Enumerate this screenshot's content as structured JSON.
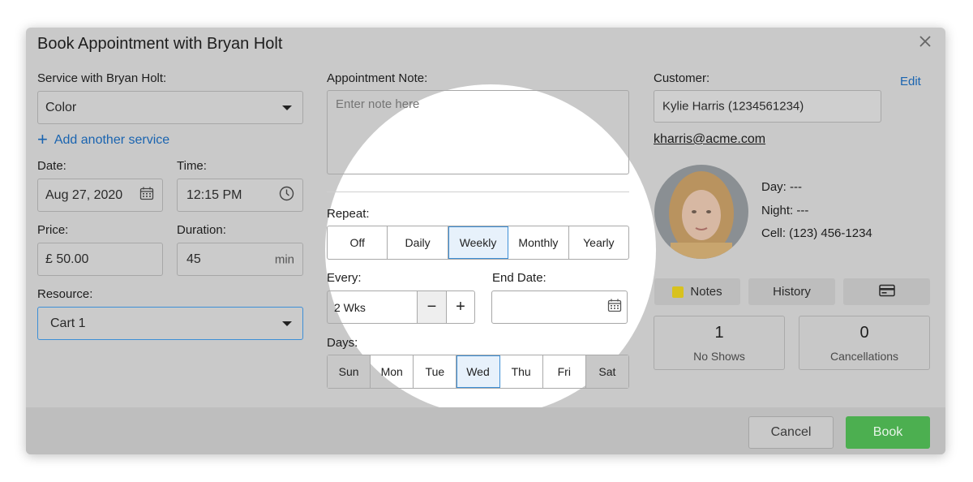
{
  "dialog": {
    "title": "Book Appointment with Bryan Holt"
  },
  "service": {
    "label": "Service with Bryan Holt:",
    "value": "Color",
    "add_link": "Add another service"
  },
  "date": {
    "label": "Date:",
    "value": "Aug 27, 2020"
  },
  "time": {
    "label": "Time:",
    "value": "12:15 PM"
  },
  "price": {
    "label": "Price:",
    "value": "£ 50.00"
  },
  "duration": {
    "label": "Duration:",
    "value": "45",
    "unit": "min"
  },
  "resource": {
    "label": "Resource:",
    "value": "Cart 1"
  },
  "note": {
    "label": "Appointment Note:",
    "placeholder": "Enter note here"
  },
  "repeat": {
    "label": "Repeat:",
    "options": [
      "Off",
      "Daily",
      "Weekly",
      "Monthly",
      "Yearly"
    ],
    "selected": "Weekly"
  },
  "every": {
    "label": "Every:",
    "value": "2  Wks",
    "minus": "−",
    "plus": "+"
  },
  "end_date": {
    "label": "End Date:",
    "value": ""
  },
  "days": {
    "label": "Days:",
    "options": [
      "Sun",
      "Mon",
      "Tue",
      "Wed",
      "Thu",
      "Fri",
      "Sat"
    ],
    "selected": "Wed"
  },
  "customer": {
    "label": "Customer:",
    "edit": "Edit",
    "name": "Kylie Harris (1234561234)",
    "email": "kharris@acme.com",
    "day": "Day: ---",
    "night": "Night: ---",
    "cell": "Cell: (123) 456-1234"
  },
  "tabs": {
    "notes": "Notes",
    "history": "History"
  },
  "stats": {
    "no_shows": {
      "value": "1",
      "label": "No Shows"
    },
    "cancellations": {
      "value": "0",
      "label": "Cancellations"
    }
  },
  "footer": {
    "cancel": "Cancel",
    "book": "Book"
  },
  "colors": {
    "accent": "#1a64b0",
    "selected_border": "#3d8fd6",
    "book_button": "#4caf50",
    "note_tag": "#d8c21f"
  }
}
